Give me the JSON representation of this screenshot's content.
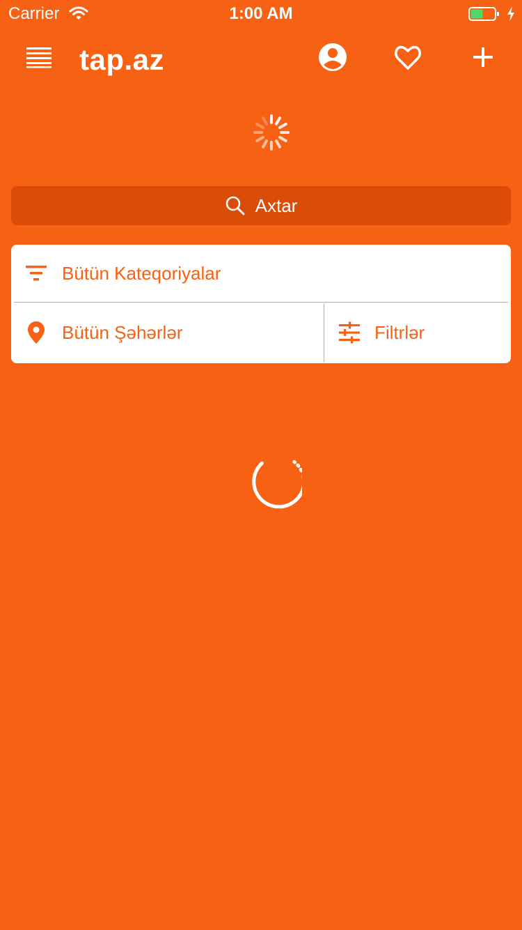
{
  "status_bar": {
    "carrier": "Carrier",
    "time": "1:00 AM",
    "battery_color": "#4cd964"
  },
  "nav": {
    "title": "tap.az",
    "icons": {
      "menu": "list-menu-icon",
      "profile": "account-circle-icon",
      "favorites": "heart-outline-icon",
      "add": "plus-icon"
    }
  },
  "search": {
    "label": "Axtar",
    "icon": "search-icon"
  },
  "filters": {
    "category_label": "Bütün Kateqoriyalar",
    "city_label": "Bütün Şəhərlər",
    "filters_label": "Filtrlər",
    "icons": {
      "category": "filter-list-icon",
      "city": "location-pin-icon",
      "filters": "sliders-icon"
    }
  },
  "colors": {
    "background": "#f66114",
    "search_background": "#db4c08",
    "card_background": "#ffffff",
    "accent": "#f66114",
    "divider": "#f0a070"
  }
}
